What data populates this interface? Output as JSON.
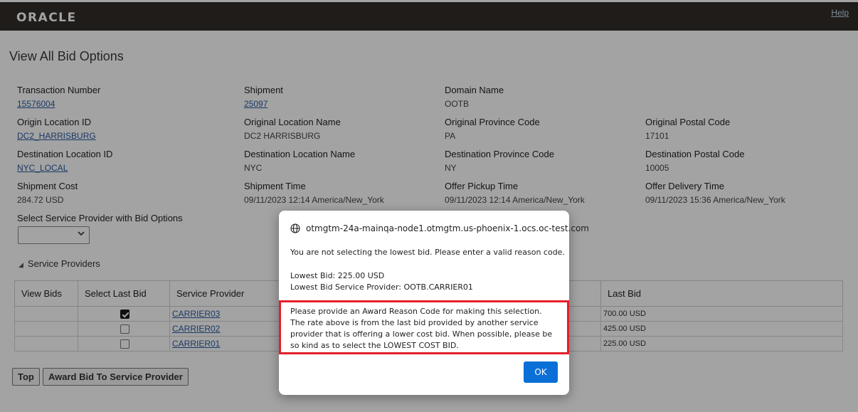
{
  "header": {
    "logo": "ORACLE",
    "help": "Help"
  },
  "page": {
    "title": "View All Bid Options"
  },
  "fields": {
    "transaction_number": {
      "label": "Transaction Number",
      "value": "15576004"
    },
    "shipment": {
      "label": "Shipment",
      "value": "25097"
    },
    "domain_name": {
      "label": "Domain Name",
      "value": "OOTB"
    },
    "origin_location_id": {
      "label": "Origin Location ID",
      "value": "DC2_HARRISBURG"
    },
    "original_location_name": {
      "label": "Original Location Name",
      "value": "DC2 HARRISBURG"
    },
    "original_province_code": {
      "label": "Original Province Code",
      "value": "PA"
    },
    "original_postal_code": {
      "label": "Original Postal Code",
      "value": "17101"
    },
    "destination_location_id": {
      "label": "Destination Location ID",
      "value": "NYC_LOCAL"
    },
    "destination_location_name": {
      "label": "Destination Location Name",
      "value": "NYC"
    },
    "destination_province_code": {
      "label": "Destination Province Code",
      "value": "NY"
    },
    "destination_postal_code": {
      "label": "Destination Postal Code",
      "value": "10005"
    },
    "shipment_cost": {
      "label": "Shipment Cost",
      "value": "284.72 USD"
    },
    "shipment_time": {
      "label": "Shipment Time",
      "value": "09/11/2023 12:14 America/New_York"
    },
    "offer_pickup_time": {
      "label": "Offer Pickup Time",
      "value": "09/11/2023 12:14 America/New_York"
    },
    "offer_delivery_time": {
      "label": "Offer Delivery Time",
      "value": "09/11/2023 15:36 America/New_York"
    },
    "select_provider": {
      "label": "Select Service Provider with Bid Options",
      "value": ""
    }
  },
  "service_providers": {
    "section_title": "Service Providers",
    "columns": [
      "View Bids",
      "Select Last Bid",
      "Service Provider",
      "Last Bid"
    ],
    "rows": [
      {
        "view_bids": "",
        "selected": true,
        "provider": "CARRIER03",
        "last_bid": "700.00 USD"
      },
      {
        "view_bids": "",
        "selected": false,
        "provider": "CARRIER02",
        "last_bid": "425.00 USD"
      },
      {
        "view_bids": "",
        "selected": false,
        "provider": "CARRIER01",
        "last_bid": "225.00 USD"
      }
    ]
  },
  "buttons": {
    "top": "Top",
    "award": "Award Bid To Service Provider"
  },
  "dialog": {
    "origin": "otmgtm-24a-mainqa-node1.otmgtm.us-phoenix-1.ocs.oc-test.com",
    "message": "You are not selecting the lowest bid. Please enter a valid reason code.",
    "lowest_bid": "Lowest Bid: 225.00 USD",
    "lowest_bid_provider": "Lowest Bid Service Provider: OOTB.CARRIER01",
    "reason_text": "Please provide an Award Reason Code for making this selection. The rate above is from the last bid provided by another service provider that is offering a lower cost bid.  When possible, please be so kind as to select the LOWEST COST BID.",
    "ok": "OK"
  },
  "colors": {
    "header_bg": "#312d2a",
    "highlight_border": "#e3202a",
    "ok_button": "#0a6fd6",
    "link": "#2a5aa0"
  },
  "icons": {
    "globe": "globe-icon",
    "dropdown": "chevron-down-icon",
    "collapse": "triangle-collapse-icon",
    "check": "checkbox-checked-icon"
  }
}
